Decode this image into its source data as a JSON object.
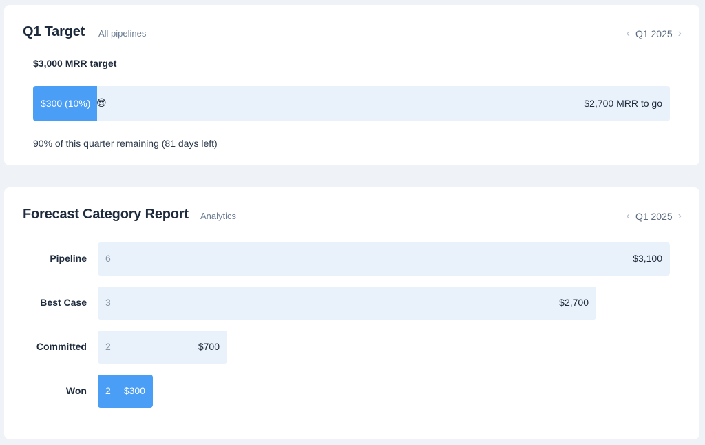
{
  "target_card": {
    "title": "Q1 Target",
    "subtitle": "All pipelines",
    "period": "Q1 2025",
    "goal_label": "$3,000 MRR target",
    "progress_fraction": 0.1,
    "progress_label": "$300 (10%)",
    "progress_emoji": "😎",
    "to_go_label": "$2,700 MRR to go",
    "remaining_text": "90% of this quarter remaining (81 days left)",
    "accent_color": "#4a9ef5",
    "track_color": "#e9f1fb"
  },
  "forecast_card": {
    "title": "Forecast Category Report",
    "subtitle": "Analytics",
    "period": "Q1 2025",
    "rows": [
      {
        "label": "Pipeline",
        "count": "6",
        "amount": "$3,100",
        "value": 3100,
        "highlight": false
      },
      {
        "label": "Best Case",
        "count": "3",
        "amount": "$2,700",
        "value": 2700,
        "highlight": false
      },
      {
        "label": "Committed",
        "count": "2",
        "amount": "$700",
        "value": 700,
        "highlight": false
      },
      {
        "label": "Won",
        "count": "2",
        "amount": "$300",
        "value": 300,
        "highlight": true
      }
    ]
  },
  "chart_data": {
    "type": "bar",
    "orientation": "horizontal",
    "title": "Forecast Category Report",
    "categories": [
      "Pipeline",
      "Best Case",
      "Committed",
      "Won"
    ],
    "values": [
      3100,
      2700,
      700,
      300
    ],
    "counts": [
      6,
      3,
      2,
      2
    ],
    "data_labels": [
      "$3,100",
      "$2,700",
      "$700",
      "$300"
    ],
    "xlabel": "",
    "ylabel": "",
    "xlim": [
      0,
      3100
    ],
    "grid": false
  }
}
